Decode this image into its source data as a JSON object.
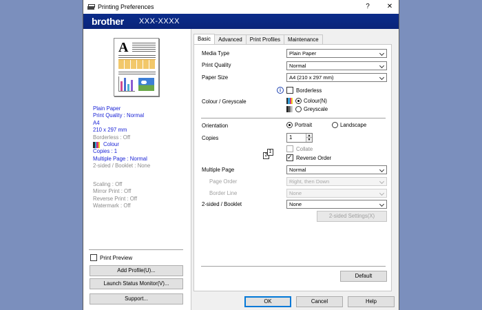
{
  "window": {
    "title": "Printing Preferences",
    "help": "?",
    "close": "✕"
  },
  "banner": {
    "brand": "brother",
    "model": "XXX-XXXX"
  },
  "summary": {
    "media": "Plain Paper",
    "quality": "Print Quality : Normal",
    "size": "A4",
    "dims": "210 x 297 mm",
    "borderless": "Borderless : Off",
    "colour": "Colour",
    "copies": "Copies : 1",
    "multiple": "Multiple Page : Normal",
    "twosided": "2-sided / Booklet : None",
    "scaling": "Scaling : Off",
    "mirror": "Mirror Print : Off",
    "reverse": "Reverse Print : Off",
    "watermark": "Watermark : Off"
  },
  "left": {
    "print_preview": "Print Preview",
    "add_profile": "Add Profile(U)...",
    "status_monitor": "Launch Status Monitor(V)...",
    "support": "Support..."
  },
  "tabs": [
    "Basic",
    "Advanced",
    "Print Profiles",
    "Maintenance"
  ],
  "basic": {
    "media_type_label": "Media Type",
    "media_type_value": "Plain Paper",
    "print_quality_label": "Print Quality",
    "print_quality_value": "Normal",
    "paper_size_label": "Paper Size",
    "paper_size_value": "A4 (210 x 297 mm)",
    "borderless_label": "Borderless",
    "colour_label": "Colour / Greyscale",
    "colour_option": "Colour(N)",
    "greyscale_option": "Greyscale",
    "orientation_label": "Orientation",
    "portrait": "Portrait",
    "landscape": "Landscape",
    "copies_label": "Copies",
    "copies_value": "1",
    "collate": "Collate",
    "reverse_order": "Reverse Order",
    "multiple_page_label": "Multiple Page",
    "multiple_page_value": "Normal",
    "page_order_label": "Page Order",
    "page_order_value": "Right, then Down",
    "border_line_label": "Border Line",
    "border_line_value": "None",
    "twosided_label": "2-sided / Booklet",
    "twosided_value": "None",
    "twosided_settings": "2-sided Settings(X)",
    "default": "Default"
  },
  "footer": {
    "ok": "OK",
    "cancel": "Cancel",
    "help": "Help"
  },
  "colors": {
    "banner": "#0b2c8a",
    "summary_text": "#1a23d6",
    "desktop": "#7b8fbd"
  }
}
